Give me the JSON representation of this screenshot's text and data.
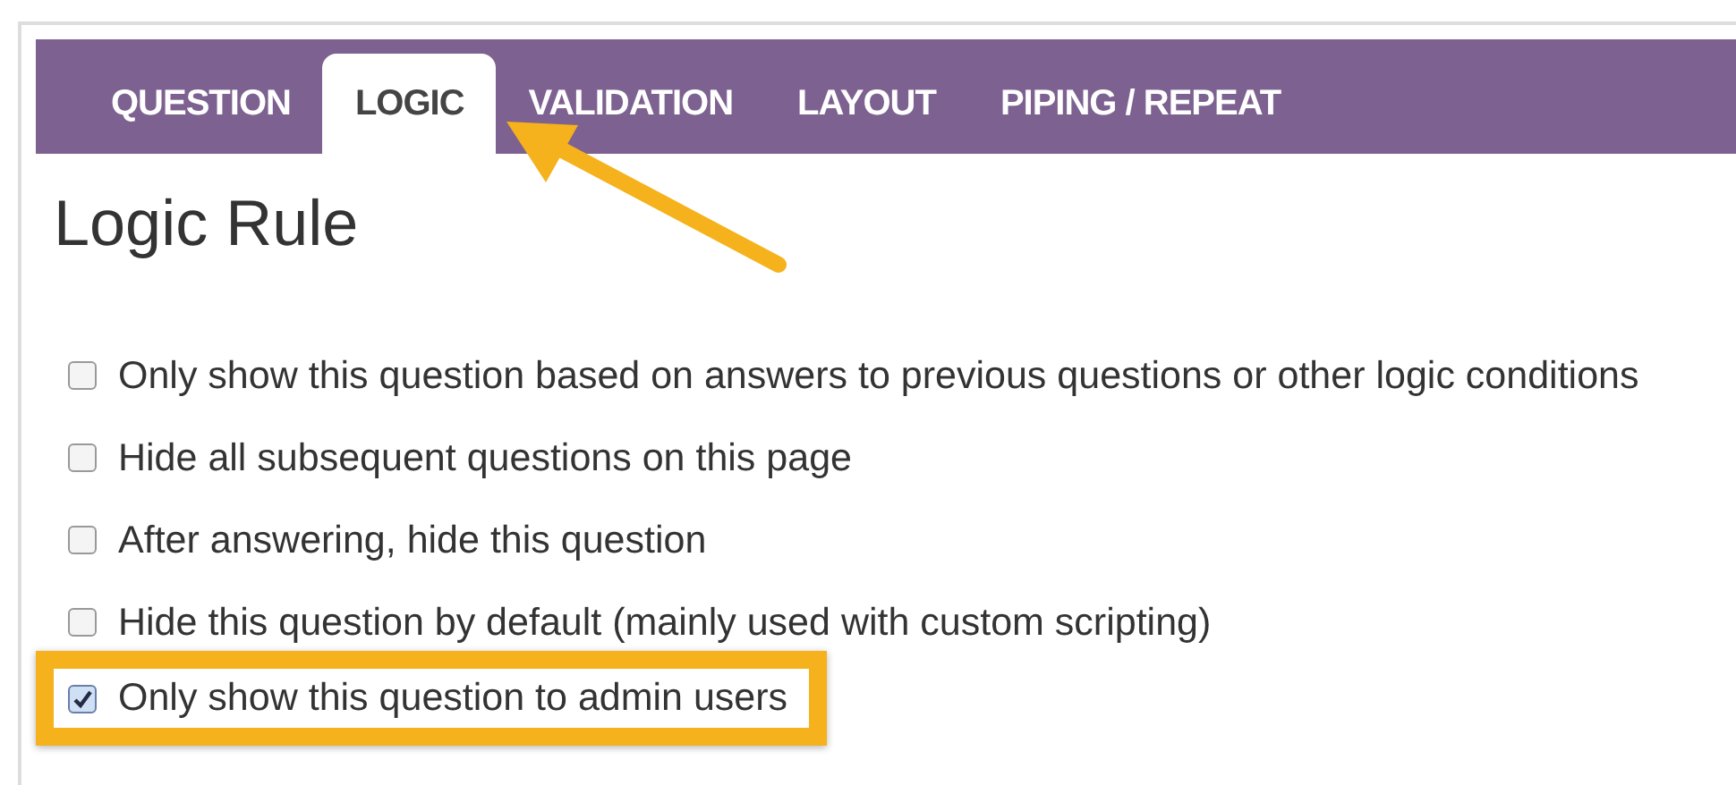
{
  "tabs": [
    {
      "label": "QUESTION",
      "selected": false
    },
    {
      "label": "LOGIC",
      "selected": true
    },
    {
      "label": "VALIDATION",
      "selected": false
    },
    {
      "label": "LAYOUT",
      "selected": false
    },
    {
      "label": "PIPING / REPEAT",
      "selected": false
    }
  ],
  "heading": "Logic Rule",
  "options": [
    {
      "label": "Only show this question based on answers to previous questions or other logic conditions",
      "checked": false,
      "highlighted": false
    },
    {
      "label": "Hide all subsequent questions on this page",
      "checked": false,
      "highlighted": false
    },
    {
      "label": "After answering, hide this question",
      "checked": false,
      "highlighted": false
    },
    {
      "label": "Hide this question by default (mainly used with custom scripting)",
      "checked": false,
      "highlighted": false
    },
    {
      "label": "Only show this question to admin users",
      "checked": true,
      "highlighted": true
    }
  ]
}
